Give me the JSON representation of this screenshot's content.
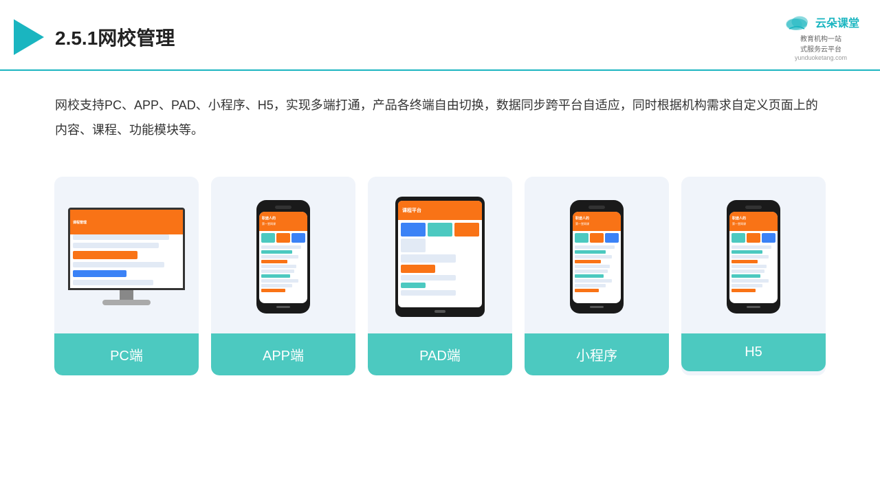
{
  "header": {
    "title": "2.5.1网校管理",
    "logo_name": "云朵课堂",
    "logo_url": "yunduoketang.com",
    "logo_subtitle": "教育机构一站\n式服务云平台"
  },
  "description": {
    "text": "网校支持PC、APP、PAD、小程序、H5，实现多端打通，产品各终端自由切换，数据同步跨平台自适应，同时根据机构需求自定义页面上的内容、课程、功能模块等。"
  },
  "cards": [
    {
      "id": "pc",
      "label": "PC端"
    },
    {
      "id": "app",
      "label": "APP端"
    },
    {
      "id": "pad",
      "label": "PAD端"
    },
    {
      "id": "miniprogram",
      "label": "小程序"
    },
    {
      "id": "h5",
      "label": "H5"
    }
  ],
  "accent_color": "#4cc9c0"
}
